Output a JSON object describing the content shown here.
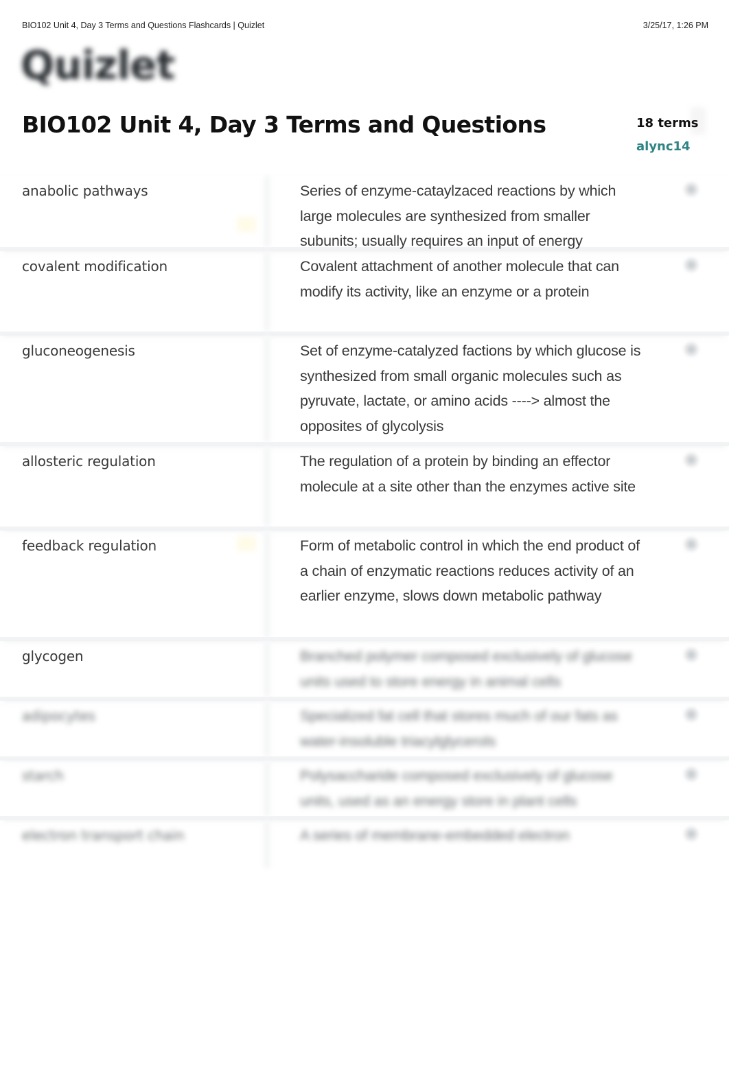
{
  "print_header": {
    "title": "BIO102 Unit 4, Day 3 Terms and Questions Flashcards | Quizlet",
    "date": "3/25/17, 1:26 PM"
  },
  "logo": {
    "text": "Quizlet"
  },
  "set": {
    "title": "BIO102 Unit 4, Day 3 Terms and Questions",
    "term_count": "18 terms",
    "author": "alync14",
    "author_color": "#2e8383"
  },
  "terms": [
    {
      "term": "anabolic pathways",
      "definition": "Series of enzyme-cataylzaced reactions by which large molecules are synthesized from smaller subunits; usually requires an input of energy",
      "icon": "star-icon"
    },
    {
      "term": "covalent modification",
      "definition": "Covalent attachment of another molecule that can modify its activity, like an enzyme or a protein",
      "icon": "star-icon"
    },
    {
      "term": "gluconeogenesis",
      "definition": "Set of enzyme-catalyzed factions by which glucose is synthesized from small organic molecules such as pyruvate, lactate, or amino acids ----> almost the opposites of glycolysis",
      "icon": "star-icon"
    },
    {
      "term": "allosteric regulation",
      "definition": "The regulation of a protein by binding an effector molecule at a site other than the enzymes active site",
      "icon": "star-icon"
    },
    {
      "term": "feedback regulation",
      "definition": "Form of metabolic control in which the end product of a chain of enzymatic reactions reduces activity of an earlier enzyme, slows down metabolic pathway",
      "icon": "star-icon"
    },
    {
      "term": "glycogen",
      "definition": "Branched polymer composed exclusively of glucose units used to store energy in animal cells",
      "icon": "star-icon"
    },
    {
      "term": "adipocytes",
      "definition": "Specialized fat cell that stores much of our fats as water-insoluble triacylglycerols",
      "icon": "star-icon"
    },
    {
      "term": "starch",
      "definition": "Polysaccharide composed exclusively of glucose units, used as an energy store in plant cells",
      "icon": "star-icon"
    },
    {
      "term": "electron transport chain",
      "definition": "A series of membrane-embedded electron",
      "icon": "star-icon"
    }
  ]
}
